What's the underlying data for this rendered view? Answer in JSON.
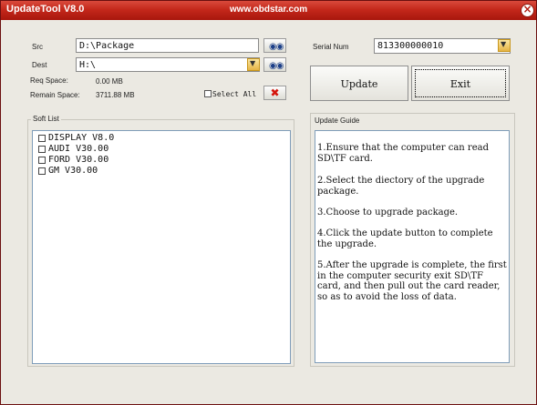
{
  "window": {
    "title": "UpdateTool  V8.0",
    "url": "www.obdstar.com",
    "close_glyph": "×"
  },
  "src": {
    "label": "Src",
    "value": "D:\\Package"
  },
  "dest": {
    "label": "Dest",
    "value": "H:\\"
  },
  "req_space": {
    "label": "Req Space:",
    "value": "0.00 MB"
  },
  "remain_space": {
    "label": "Remain Space:",
    "value": "3711.88 MB"
  },
  "select_all": {
    "label": "Select All"
  },
  "serial": {
    "label": "Serial Num",
    "value": "813300000010"
  },
  "buttons": {
    "update": "Update",
    "exit": "Exit"
  },
  "soft_list": {
    "title": "Soft List",
    "items": [
      "DISPLAY V8.0",
      "AUDI V30.00",
      "FORD V30.00",
      "GM V30.00"
    ]
  },
  "guide": {
    "title": "Update Guide",
    "steps": [
      "1.Ensure that the computer can read SD\\TF card.",
      "2.Select the diectory of the upgrade package.",
      "3.Choose to upgrade package.",
      "4.Click the update button to complete the upgrade.",
      "5.After the upgrade is complete, the first in the computer security exit SD\\TF card, and then pull out the card reader, so as to avoid the loss of data."
    ]
  },
  "icons": {
    "browse": "binoculars-icon",
    "dropdown": "chevron-down-icon",
    "clear": "red-x-icon",
    "close": "close-icon"
  },
  "colors": {
    "titlebar": "#c4281b",
    "clear_x": "#d4140b",
    "binoculars": "#1c3f88"
  }
}
